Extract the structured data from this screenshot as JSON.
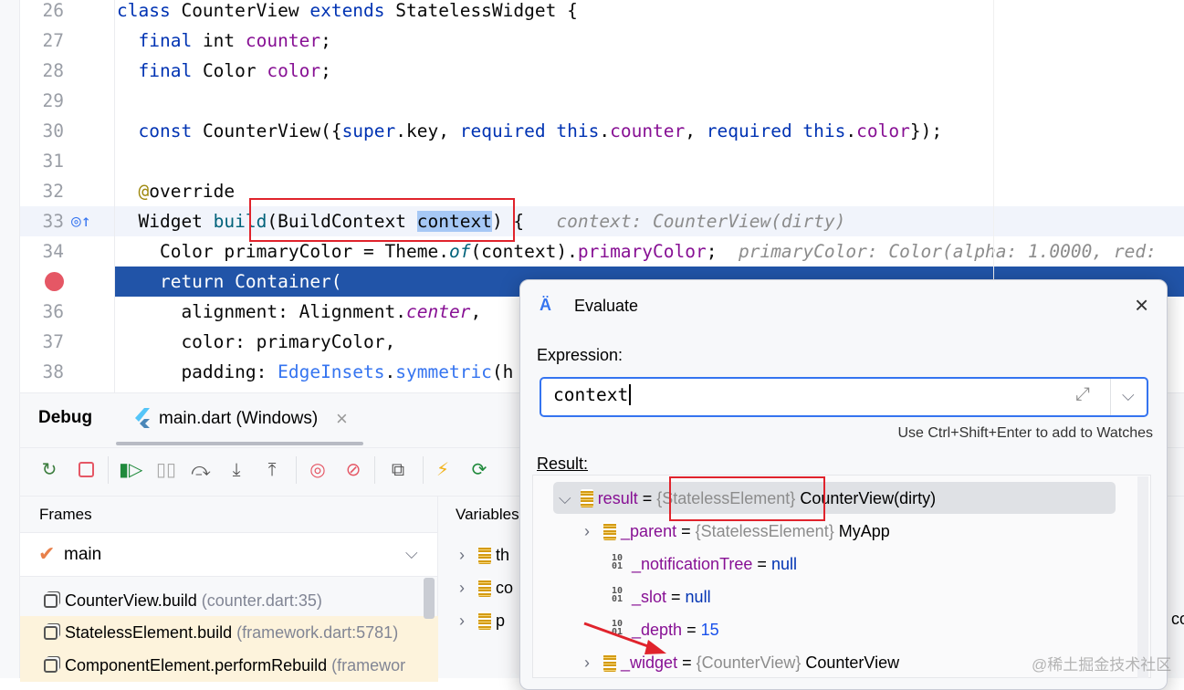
{
  "editor": {
    "lines": [
      {
        "n": "26",
        "tokens": [
          [
            "kw",
            "class "
          ],
          [
            "",
            "CounterView "
          ],
          [
            "kw",
            "extends "
          ],
          [
            "",
            "StatelessWidget {"
          ]
        ]
      },
      {
        "n": "27",
        "tokens": [
          [
            "",
            "  "
          ],
          [
            "kw",
            "final "
          ],
          [
            "",
            "int "
          ],
          [
            "fld",
            "counter"
          ],
          [
            "",
            ";"
          ]
        ]
      },
      {
        "n": "28",
        "tokens": [
          [
            "",
            "  "
          ],
          [
            "kw",
            "final "
          ],
          [
            "",
            "Color "
          ],
          [
            "fld",
            "color"
          ],
          [
            "",
            ";"
          ]
        ]
      },
      {
        "n": "29",
        "tokens": []
      },
      {
        "n": "30",
        "tokens": [
          [
            "",
            "  "
          ],
          [
            "kw",
            "const "
          ],
          [
            "",
            "CounterView({"
          ],
          [
            "kw",
            "super"
          ],
          [
            "",
            ".key, "
          ],
          [
            "kw",
            "required this"
          ],
          [
            "",
            "."
          ],
          [
            "fld",
            "counter"
          ],
          [
            "",
            ", "
          ],
          [
            "kw",
            "required this"
          ],
          [
            "",
            "."
          ],
          [
            "fld",
            "color"
          ],
          [
            "",
            "});"
          ]
        ]
      },
      {
        "n": "31",
        "tokens": []
      },
      {
        "n": "32",
        "tokens": [
          [
            "",
            "  "
          ],
          [
            "ann",
            "@"
          ],
          [
            "",
            "override"
          ]
        ]
      },
      {
        "n": "33",
        "tokens": [
          [
            "",
            "  Widget "
          ],
          [
            "fn",
            "build"
          ],
          [
            "",
            "(BuildContext "
          ],
          [
            "selword",
            "context"
          ],
          [
            "",
            ") {   "
          ],
          [
            "hint",
            "context: CounterView(dirty)"
          ]
        ]
      },
      {
        "n": "34",
        "tokens": [
          [
            "",
            "    Color primaryColor = Theme."
          ],
          [
            "fn it",
            "of"
          ],
          [
            "",
            "(context)."
          ],
          [
            "fld",
            "primaryColor"
          ],
          [
            "",
            ";  "
          ],
          [
            "hint",
            "primaryColor: Color(alpha: 1.0000, red:"
          ]
        ]
      },
      {
        "n": "",
        "tokens": [
          [
            "",
            "    return Container("
          ]
        ]
      },
      {
        "n": "36",
        "tokens": [
          [
            "",
            "      alignment: Alignment."
          ],
          [
            "fld it",
            "center"
          ],
          [
            "",
            ","
          ]
        ]
      },
      {
        "n": "37",
        "tokens": [
          [
            "",
            "      color: primaryColor,"
          ]
        ]
      },
      {
        "n": "38",
        "tokens": [
          [
            "",
            "      padding: "
          ],
          [
            "cls",
            "EdgeInsets"
          ],
          [
            "",
            "."
          ],
          [
            "cls",
            "symmetric"
          ],
          [
            "",
            "(h"
          ]
        ]
      }
    ]
  },
  "debug": {
    "title": "Debug",
    "tab": "main.dart (Windows)",
    "close": "×",
    "frames_header": "Frames",
    "variables_header": "Variables",
    "thread": "main",
    "frames": [
      {
        "name": "CounterView.build",
        "loc": "(counter.dart:35)"
      },
      {
        "name": "StatelessElement.build",
        "loc": "(framework.dart:5781)"
      },
      {
        "name": "ComponentElement.performRebuild",
        "loc": "(framewor"
      }
    ],
    "variables": [
      "th",
      "co",
      "p"
    ]
  },
  "dialog": {
    "title": "Evaluate",
    "expression_label": "Expression:",
    "expression_value": "context",
    "hint": "Use Ctrl+Shift+Enter to add to Watches",
    "result_label": "Result:",
    "result": {
      "name": "result",
      "type": "{StatelessElement}",
      "value": "CounterView(dirty)"
    },
    "children": [
      {
        "name": "_parent",
        "type": "{StatelessElement}",
        "value": "MyApp",
        "kind": "object"
      },
      {
        "name": "_notificationTree",
        "value": "null",
        "kind": "null"
      },
      {
        "name": "_slot",
        "value": "null",
        "kind": "null"
      },
      {
        "name": "_depth",
        "value": "15",
        "kind": "num"
      },
      {
        "name": "_widget",
        "type": "{CounterView}",
        "value": "CounterView",
        "kind": "object"
      }
    ]
  },
  "behind_text": "co",
  "watermark": "@稀土掘金技术社区"
}
